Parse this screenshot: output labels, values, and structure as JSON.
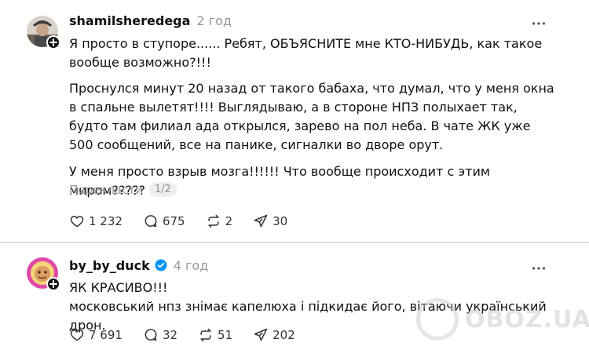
{
  "posts": [
    {
      "username": "shamilsheredega",
      "time": "2 год",
      "paragraphs": [
        "Я просто в ступоре...... Ребят, ОБЪЯСНИТЕ мне КТО-НИБУДЬ, как такое вообще возможно?!!!",
        "Проснулся минут 20 назад от такого бабаха, что думал, что у меня окна в спальне вылетят!!!! Выглядываю, а в стороне НПЗ полыхает так, будто там филиал ада открылся, зарево на пол неба. В чате ЖК уже 500 сообщений, все на панике, сигналки во дворе орут.",
        "У меня просто взрыв мозга!!!!!! Что вообще происходит с этим миром?????"
      ],
      "translate_label": "Перекласти",
      "translate_page": "1/2",
      "likes": "1 232",
      "comments": "675",
      "reposts": "2",
      "shares": "30"
    },
    {
      "username": "by_by_duck",
      "verified": true,
      "time": "4 год",
      "paragraphs": [
        "ЯК КРАСИВО!!!",
        "московський нпз знімає капелюха і підкидає його, вітаючи український дрон."
      ],
      "likes": "7 691",
      "comments": "32",
      "reposts": "51",
      "shares": "202"
    }
  ],
  "watermark": "OBOZ.UA",
  "colors": {
    "text": "#101010",
    "muted": "#999999",
    "verified": "#0095f6"
  }
}
